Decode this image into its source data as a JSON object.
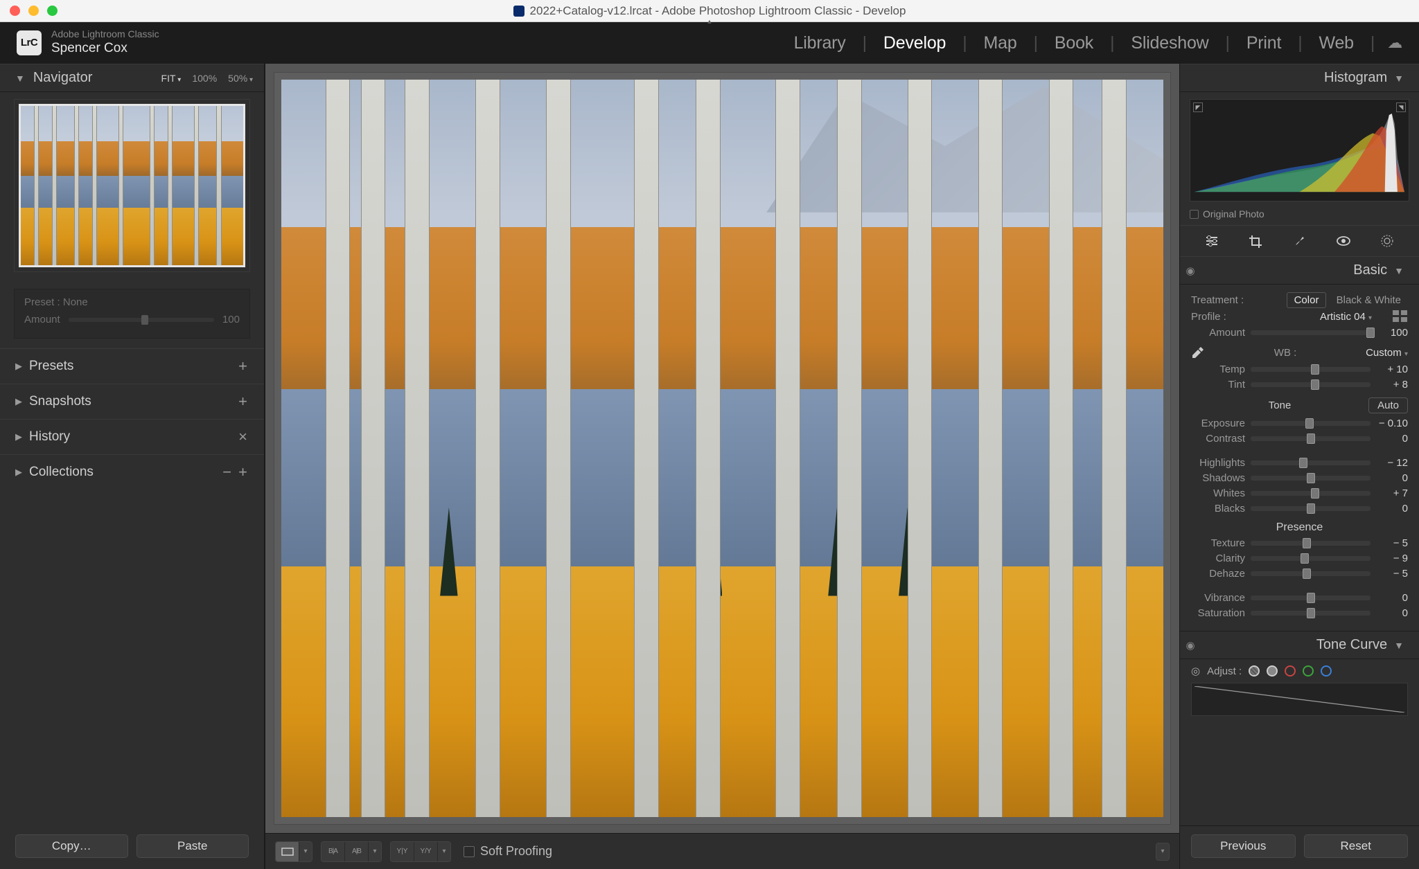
{
  "window": {
    "title": "2022+Catalog-v12.lrcat - Adobe Photoshop Lightroom Classic - Develop"
  },
  "identity": {
    "logo": "LrC",
    "brand": "Adobe Lightroom Classic",
    "user": "Spencer Cox"
  },
  "modules": [
    "Library",
    "Develop",
    "Map",
    "Book",
    "Slideshow",
    "Print",
    "Web"
  ],
  "active_module": "Develop",
  "left": {
    "navigator": {
      "title": "Navigator",
      "zoom_levels": [
        "FIT",
        "100%",
        "50%"
      ],
      "zoom_selected": "FIT"
    },
    "preset_box": {
      "preset_label": "Preset :",
      "preset_value": "None",
      "amount_label": "Amount",
      "amount_value": "100"
    },
    "sections": {
      "presets": {
        "label": "Presets",
        "tail": "+"
      },
      "snapshots": {
        "label": "Snapshots",
        "tail": "+"
      },
      "history": {
        "label": "History",
        "tail": "×"
      },
      "collections": {
        "label": "Collections",
        "tail": "−  +"
      }
    },
    "footer": {
      "copy": "Copy…",
      "paste": "Paste"
    }
  },
  "toolbar": {
    "soft_proofing": "Soft Proofing"
  },
  "right": {
    "histogram": {
      "title": "Histogram",
      "original_photo": "Original Photo"
    },
    "basic": {
      "title": "Basic",
      "treatment_label": "Treatment :",
      "treatment_color": "Color",
      "treatment_bw": "Black & White",
      "profile_label": "Profile :",
      "profile_value": "Artistic 04",
      "amount_label": "Amount",
      "amount_value": "100",
      "wb_label": "WB :",
      "wb_value": "Custom",
      "tone_label": "Tone",
      "auto": "Auto",
      "presence_label": "Presence",
      "sliders": {
        "temp": {
          "label": "Temp",
          "value": "+ 10",
          "pos": 54
        },
        "tint": {
          "label": "Tint",
          "value": "+ 8",
          "pos": 54
        },
        "exposure": {
          "label": "Exposure",
          "value": "− 0.10",
          "pos": 49
        },
        "contrast": {
          "label": "Contrast",
          "value": "0",
          "pos": 50
        },
        "highlights": {
          "label": "Highlights",
          "value": "− 12",
          "pos": 44
        },
        "shadows": {
          "label": "Shadows",
          "value": "0",
          "pos": 50
        },
        "whites": {
          "label": "Whites",
          "value": "+ 7",
          "pos": 54
        },
        "blacks": {
          "label": "Blacks",
          "value": "0",
          "pos": 50
        },
        "texture": {
          "label": "Texture",
          "value": "− 5",
          "pos": 47
        },
        "clarity": {
          "label": "Clarity",
          "value": "− 9",
          "pos": 45
        },
        "dehaze": {
          "label": "Dehaze",
          "value": "− 5",
          "pos": 47
        },
        "vibrance": {
          "label": "Vibrance",
          "value": "0",
          "pos": 50
        },
        "saturation": {
          "label": "Saturation",
          "value": "0",
          "pos": 50
        }
      }
    },
    "tone_curve": {
      "title": "Tone Curve",
      "adjust_label": "Adjust :"
    },
    "footer": {
      "previous": "Previous",
      "reset": "Reset"
    }
  }
}
